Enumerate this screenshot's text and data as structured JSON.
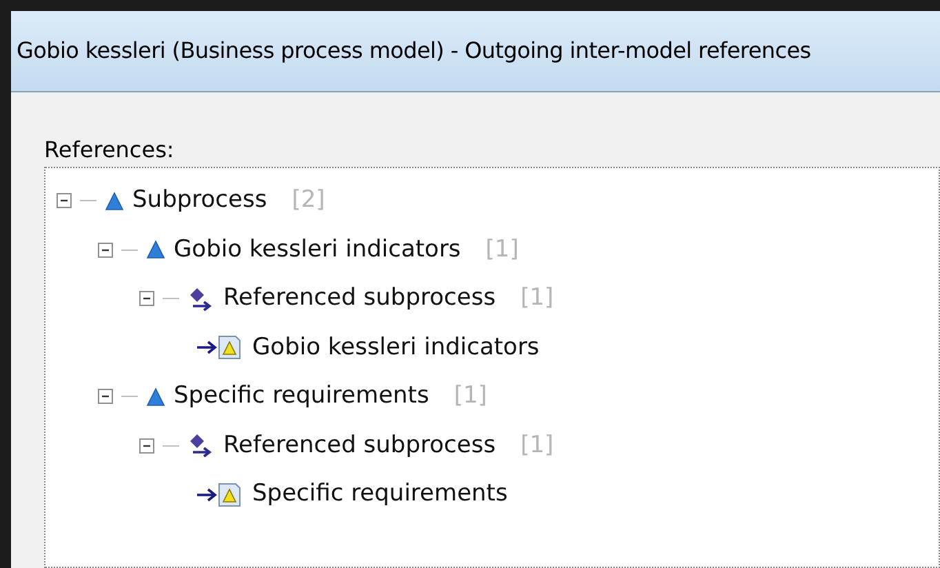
{
  "window": {
    "title": "Gobio kessleri (Business process model) - Outgoing inter-model references"
  },
  "references": {
    "label": "References:",
    "tree": [
      {
        "kind": "process",
        "label": "Subprocess",
        "count": "[2]",
        "expanded": true,
        "children": [
          {
            "kind": "process",
            "label": "Gobio kessleri indicators",
            "count": "[1]",
            "expanded": true,
            "children": [
              {
                "kind": "reference",
                "label": "Referenced subprocess",
                "count": "[1]",
                "expanded": true,
                "children": [
                  {
                    "kind": "target",
                    "label": "Gobio kessleri indicators"
                  }
                ]
              }
            ]
          },
          {
            "kind": "process",
            "label": "Specific requirements",
            "count": "[1]",
            "expanded": true,
            "children": [
              {
                "kind": "reference",
                "label": "Referenced subprocess",
                "count": "[1]",
                "expanded": true,
                "children": [
                  {
                    "kind": "target",
                    "label": "Specific requirements"
                  }
                ]
              }
            ]
          }
        ]
      }
    ]
  }
}
